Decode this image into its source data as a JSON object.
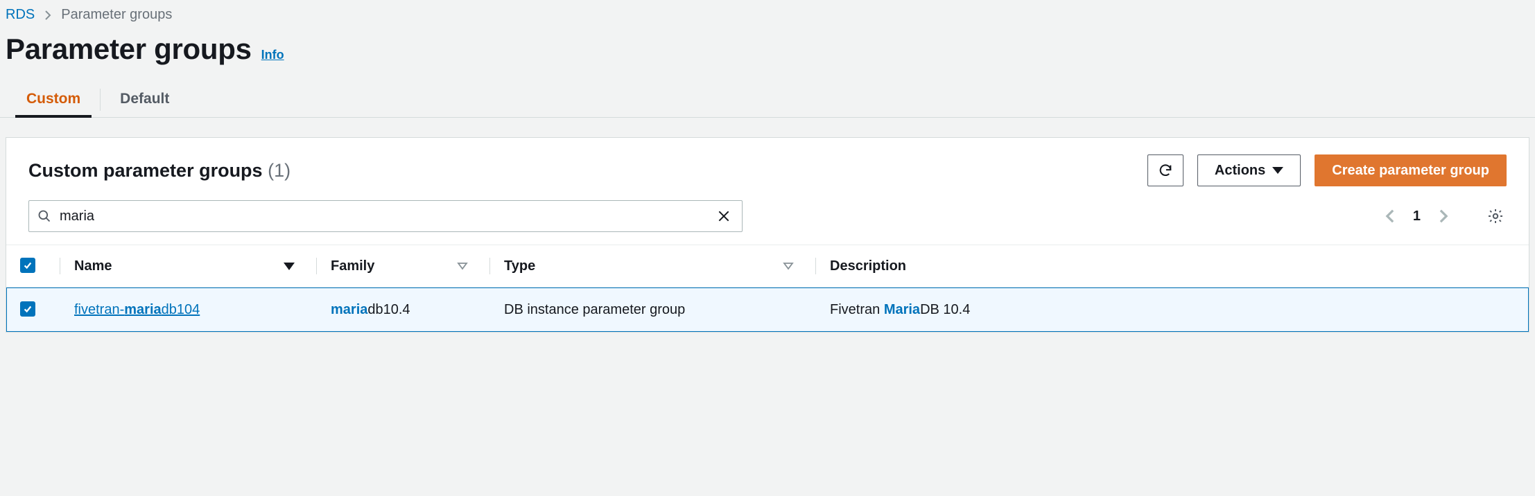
{
  "breadcrumb": {
    "root": "RDS",
    "current": "Parameter groups"
  },
  "header": {
    "title": "Parameter groups",
    "info_label": "Info"
  },
  "tabs": [
    {
      "label": "Custom",
      "active": true
    },
    {
      "label": "Default",
      "active": false
    }
  ],
  "panel": {
    "title": "Custom parameter groups",
    "count_display": "(1)",
    "actions_label": "Actions",
    "create_label": "Create parameter group"
  },
  "filter": {
    "value": "maria"
  },
  "pagination": {
    "page": "1"
  },
  "columns": {
    "name": "Name",
    "family": "Family",
    "type": "Type",
    "description": "Description"
  },
  "rows": [
    {
      "selected": true,
      "name_pre": "fivetran-",
      "name_hl": "maria",
      "name_post": "db104",
      "family_hl": "maria",
      "family_post": "db10.4",
      "type": "DB instance parameter group",
      "desc_pre": "Fivetran ",
      "desc_hl": "Maria",
      "desc_post": "DB 10.4"
    }
  ]
}
